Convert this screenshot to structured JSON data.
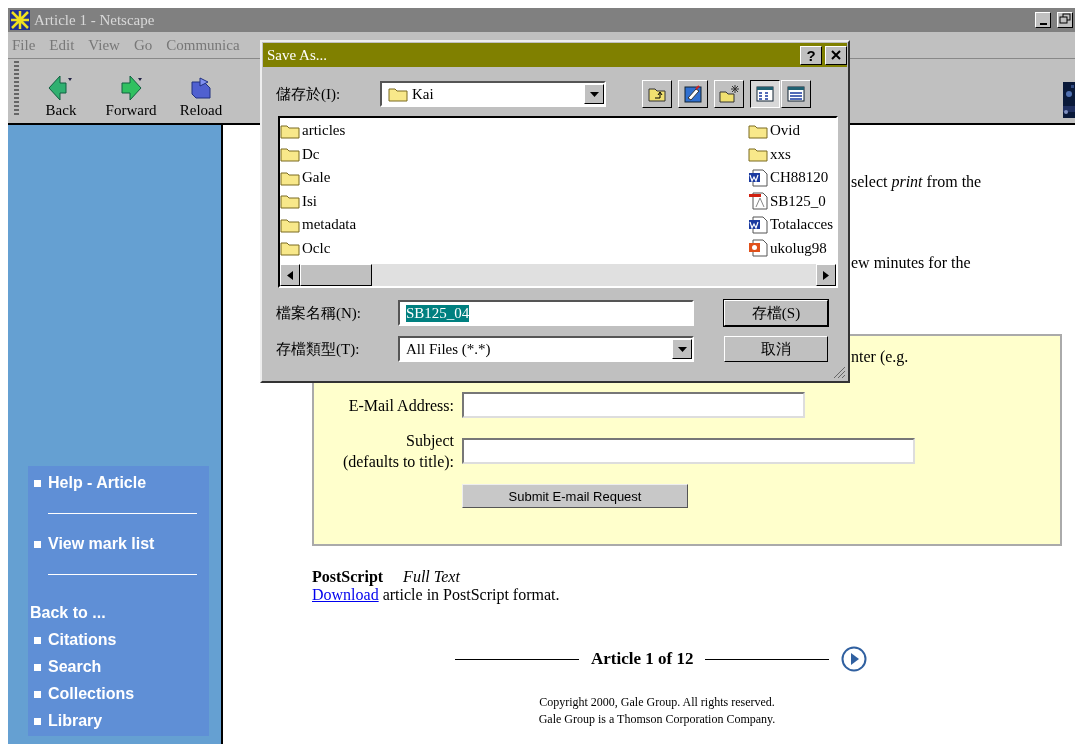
{
  "window": {
    "title": "Article 1 - Netscape"
  },
  "menu": [
    {
      "label": "File"
    },
    {
      "label": "Edit"
    },
    {
      "label": "View"
    },
    {
      "label": "Go"
    },
    {
      "label": "Communica"
    }
  ],
  "toolbar": [
    {
      "label": "Back",
      "kind": "back"
    },
    {
      "label": "Forward",
      "kind": "forward"
    },
    {
      "label": "Reload",
      "kind": "reload"
    }
  ],
  "sidebar": {
    "items": [
      {
        "kind": "link",
        "label": "Help - Article"
      },
      {
        "kind": "rule"
      },
      {
        "kind": "link",
        "label": "View mark list"
      },
      {
        "kind": "rule"
      },
      {
        "kind": "heading",
        "label": "Back to ..."
      },
      {
        "kind": "link",
        "label": "Citations"
      },
      {
        "kind": "link",
        "label": "Search"
      },
      {
        "kind": "link",
        "label": "Collections"
      },
      {
        "kind": "link",
        "label": "Library"
      }
    ]
  },
  "main": {
    "fragments": [
      "select *print* from the",
      "ew minutes for the"
    ],
    "email_form": {
      "intro": "nter (e.g.",
      "fields": [
        {
          "label_lines": [
            "E-Mail Address:"
          ]
        },
        {
          "label_lines": [
            "Subject",
            "(defaults to title):"
          ]
        }
      ],
      "submit": "Submit E-mail Request"
    },
    "postscript": {
      "title": "PostScript",
      "subtitle": "Full Text",
      "link": "Download",
      "text": "article in PostScript format."
    },
    "pager": {
      "label": "Article 1 of 12"
    },
    "copyright": [
      "Copyright   2000, Gale Group. All rights reserved.",
      "Gale Group is a Thomson Corporation Company."
    ]
  },
  "dialog": {
    "title": "Save As...",
    "help_label": "?",
    "location": {
      "label": "儲存於(I):",
      "value": "Kai"
    },
    "tools": [
      {
        "kind": "up"
      },
      {
        "kind": "desktop"
      },
      {
        "kind": "newfolder"
      },
      {
        "kind": "list",
        "selected": true
      },
      {
        "kind": "details",
        "selected": false
      }
    ],
    "files": [
      {
        "name": "articles",
        "kind": "folder"
      },
      {
        "name": "Dc",
        "kind": "folder"
      },
      {
        "name": "Gale",
        "kind": "folder"
      },
      {
        "name": "Isi",
        "kind": "folder"
      },
      {
        "name": "metadata",
        "kind": "folder"
      },
      {
        "name": "Oclc",
        "kind": "folder"
      },
      {
        "name": "Ovid",
        "kind": "folder"
      },
      {
        "name": "xxs",
        "kind": "folder"
      },
      {
        "name": "CH88120",
        "kind": "word"
      },
      {
        "name": "SB125_0",
        "kind": "pdf"
      },
      {
        "name": "Totalacces",
        "kind": "word"
      },
      {
        "name": "ukolug98",
        "kind": "slides"
      }
    ],
    "filename": {
      "label": "檔案名稱(N):",
      "value": "SB125_04"
    },
    "filetype": {
      "label": "存檔類型(T):",
      "value": "All Files (*.*)"
    },
    "buttons": [
      "存檔(S)",
      "取消"
    ]
  }
}
